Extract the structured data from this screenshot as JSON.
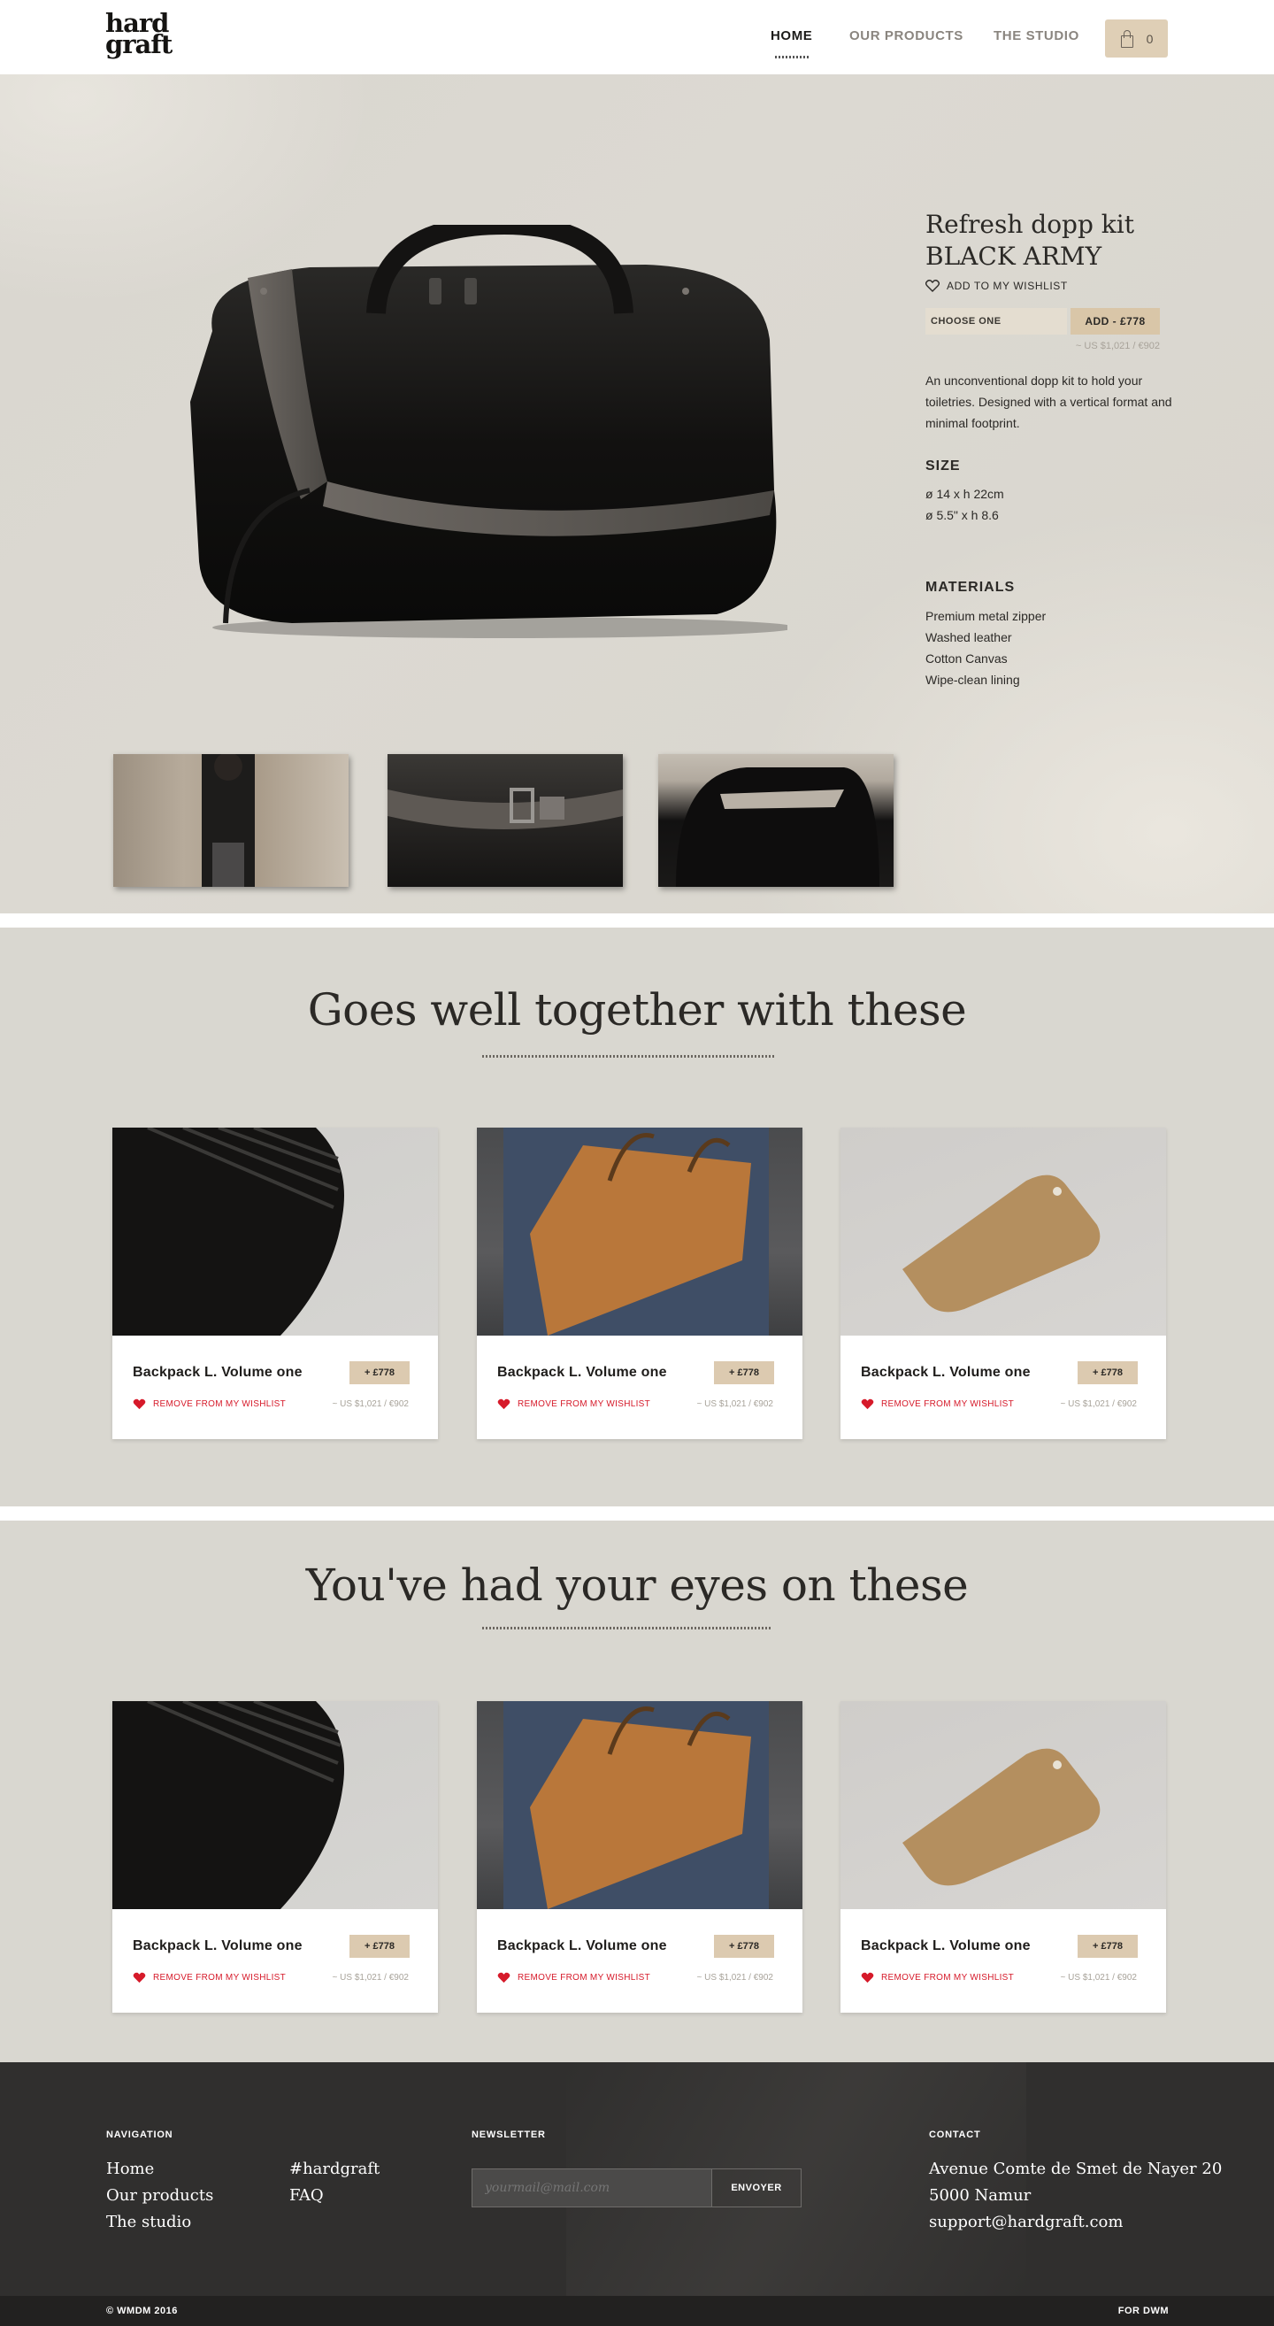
{
  "brand": {
    "logo_line1": "hard",
    "logo_line2": "graft"
  },
  "nav": {
    "items": [
      {
        "label": "HOME",
        "active": true
      },
      {
        "label": "OUR PRODUCTS",
        "active": false
      },
      {
        "label": "THE STUDIO",
        "active": false
      }
    ],
    "cart_count": "0",
    "cart_icon": "shopping-bag-icon"
  },
  "product": {
    "title_line1": "Refresh dopp kit",
    "title_line2": "BLACK ARMY",
    "wishlist_label": "ADD TO MY WISHLIST",
    "select_label": "CHOOSE ONE",
    "add_label": "ADD - £778",
    "price_alt": "~ US $1,021 / €902",
    "description": "An unconventional dopp kit to hold your toiletries. Designed with a vertical format and minimal footprint.",
    "size_heading": "SIZE",
    "sizes": [
      "ø 14 x h 22cm",
      "ø 5.5\" x h 8.6"
    ],
    "materials_heading": "MATERIALS",
    "materials": [
      "Premium metal zipper",
      "Washed leather",
      "Cotton Canvas",
      "Wipe-clean lining"
    ]
  },
  "section_together": {
    "title": "Goes well together with these",
    "cards": [
      {
        "name": "Backpack L. Volume one",
        "button": "+ £778",
        "wishlist": "REMOVE FROM MY WISHLIST",
        "price": "~ US $1,021 / €902"
      },
      {
        "name": "Backpack L. Volume one",
        "button": "+ £778",
        "wishlist": "REMOVE FROM MY WISHLIST",
        "price": "~ US $1,021 / €902"
      },
      {
        "name": "Backpack L. Volume one",
        "button": "+ £778",
        "wishlist": "REMOVE FROM MY WISHLIST",
        "price": "~ US $1,021 / €902"
      }
    ]
  },
  "section_eyes": {
    "title": "You've had your eyes on these",
    "cards": [
      {
        "name": "Backpack L. Volume one",
        "button": "+ £778",
        "wishlist": "REMOVE FROM MY WISHLIST",
        "price": "~ US $1,021 / €902"
      },
      {
        "name": "Backpack L. Volume one",
        "button": "+ £778",
        "wishlist": "REMOVE FROM MY WISHLIST",
        "price": "~ US $1,021 / €902"
      },
      {
        "name": "Backpack L. Volume one",
        "button": "+ £778",
        "wishlist": "REMOVE FROM MY WISHLIST",
        "price": "~ US $1,021 / €902"
      }
    ]
  },
  "footer": {
    "navigation_heading": "NAVIGATION",
    "nav_links": [
      "Home",
      "Our products",
      "The studio"
    ],
    "extra_links": [
      "#hardgraft",
      "FAQ"
    ],
    "newsletter_heading": "NEWSLETTER",
    "newsletter_placeholder": "yourmail@mail.com",
    "newsletter_button": "ENVOYER",
    "contact_heading": "CONTACT",
    "contact_lines": [
      "Avenue Comte de Smet de Nayer 20",
      "5000 Namur",
      "support@hardgraft.com"
    ],
    "copyright": "© WMDM 2016",
    "credit": "FOR DWM"
  },
  "colors": {
    "accent": "#dfcfb6",
    "background": "#d9d7d0",
    "wishlist_red": "#d61a2a",
    "footer": "#302f2e"
  }
}
